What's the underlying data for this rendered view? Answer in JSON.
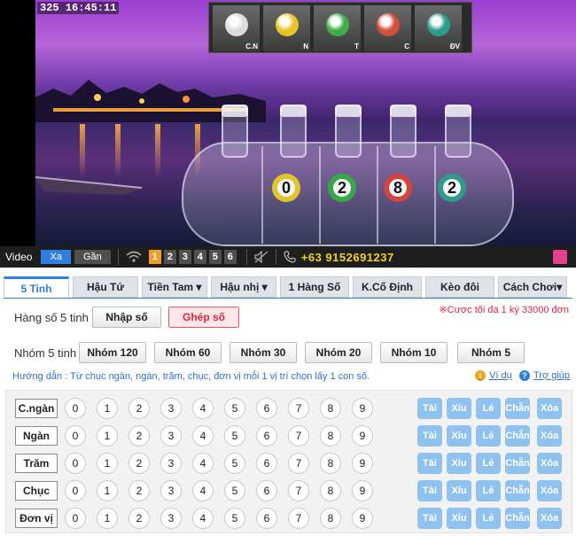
{
  "video": {
    "info": "325  16:45:11",
    "cams": [
      {
        "label": "C.N",
        "color": "#dcdcdc"
      },
      {
        "label": "N",
        "color": "#e8c523"
      },
      {
        "label": "T",
        "color": "#3fae4a"
      },
      {
        "label": "C",
        "color": "#d24f3a"
      },
      {
        "label": "ĐV",
        "color": "#2d9c8f"
      }
    ],
    "balls": [
      {
        "num": "0",
        "color": "#e2c52a"
      },
      {
        "num": "2",
        "color": "#39a84a"
      },
      {
        "num": "8",
        "color": "#d2453d"
      },
      {
        "num": "2",
        "color": "#2f9b8b"
      }
    ]
  },
  "vbar": {
    "label": "Video",
    "btn_far": "Xa",
    "btn_near": "Gần",
    "channels": [
      "1",
      "2",
      "3",
      "4",
      "5",
      "6"
    ],
    "active_channel": "1",
    "phone": "+63 9152691237"
  },
  "tabs": [
    "5 Tinh",
    "Hậu Tứ",
    "Tiền Tam ▾",
    "Hậu nhị ▾",
    "1 Hàng Số",
    "K.Cố Định",
    "Kèo đôi",
    "Cách Chơi▾"
  ],
  "form": {
    "row_label": "Hàng số 5 tinh :",
    "btn_input": "Nhập số",
    "btn_combine": "Ghép số",
    "limit_note": "※Cược tối đa 1 kỳ 33000 đơn",
    "group_label": "Nhóm 5 tinh :",
    "groups": [
      "Nhóm 120",
      "Nhóm 60",
      "Nhóm 30",
      "Nhóm 20",
      "Nhóm 10",
      "Nhóm 5"
    ],
    "guide": "Hướng dẫn : Từ chục ngàn, ngàn, trăm, chục, đơn vị mỗi 1 vị trí chọn lấy 1 con số.",
    "example": "Ví dụ",
    "help": "Trợ giúp"
  },
  "grid": {
    "rows": [
      "C.ngàn",
      "Ngàn",
      "Trăm",
      "Chục",
      "Đơn vị"
    ],
    "digits": [
      "0",
      "1",
      "2",
      "3",
      "4",
      "5",
      "6",
      "7",
      "8",
      "9"
    ],
    "quick": [
      "Tài",
      "Xỉu",
      "Lẻ",
      "Chẵn",
      "Xóa"
    ]
  },
  "colors": {
    "accent": "#2f7fe0",
    "danger": "#e0233a",
    "quick_btn": "#8fc2ef",
    "phone": "#f5d21e",
    "active_channel": "#f39c2a"
  }
}
